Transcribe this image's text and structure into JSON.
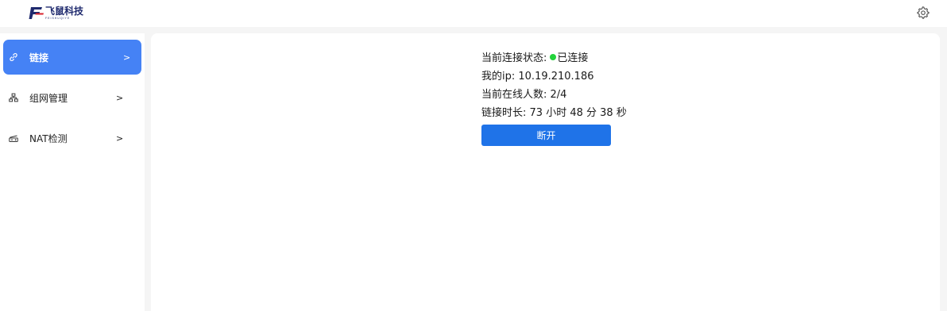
{
  "header": {
    "logo_text_cn": "飞鼠科技",
    "logo_text_en": "FEISHUQIYE",
    "settings_icon": "gear-icon"
  },
  "sidebar": {
    "items": [
      {
        "label": "链接",
        "icon": "link-icon",
        "arrow": ">",
        "active": true
      },
      {
        "label": "组网管理",
        "icon": "network-icon",
        "arrow": ">",
        "active": false
      },
      {
        "label": "NAT检测",
        "icon": "router-icon",
        "arrow": ">",
        "active": false
      }
    ]
  },
  "main": {
    "status_label": "当前连接状态:",
    "status_value": "已连接",
    "status_color": "#22d33b",
    "ip_label": "我的ip:",
    "ip_value": "10.19.210.186",
    "online_label": "当前在线人数:",
    "online_value": "2/4",
    "duration_label": "链接时长:",
    "duration_value": "73 小时 48 分 38 秒",
    "disconnect_label": "断开"
  },
  "colors": {
    "accent": "#4582f5",
    "button": "#1f73e8",
    "brand": "#1f2a6e"
  }
}
